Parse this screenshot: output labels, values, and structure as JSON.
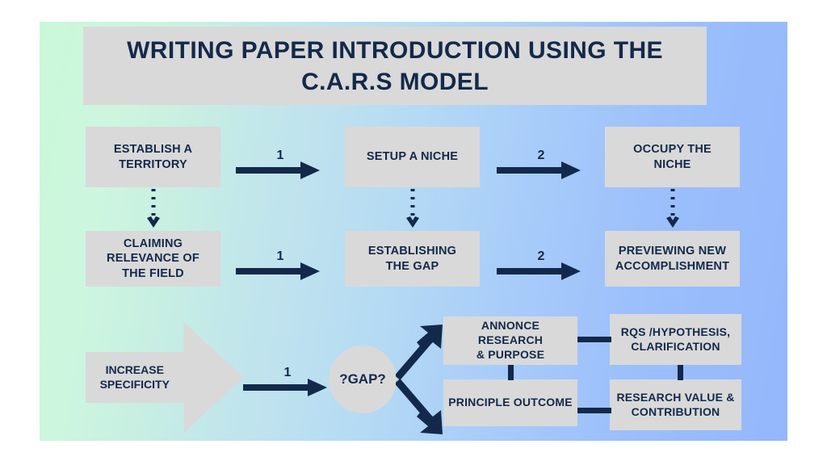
{
  "title": {
    "line1": "WRITING PAPER INTRODUCTION USING THE",
    "line2": "C.A.R.S MODEL"
  },
  "colors": {
    "node_fill": "#d9d9d9",
    "text_navy": "#13294b",
    "bg_left": "#c9f8d8",
    "bg_right": "#93b7fb",
    "page_bg": "#ffffff"
  },
  "row1": {
    "box1": "ESTABLISH A\nTERRITORY",
    "arrow1_label": "1",
    "box2": "SETUP A NICHE",
    "arrow2_label": "2",
    "box3": "OCCUPY THE\nNICHE"
  },
  "row2": {
    "box1": "CLAIMING\nRELEVANCE OF\nTHE  FIELD",
    "arrow1_label": "1",
    "box2": "ESTABLISHING\nTHE GAP",
    "arrow2_label": "2",
    "box3": "PREVIEWING NEW\nACCOMPLISHMENT"
  },
  "row3": {
    "increase": "INCREASE\nSPECIFICITY",
    "arrow1_label": "1",
    "gap": "?GAP?",
    "branch_top": "ANNONCE RESEARCH\n& PURPOSE",
    "branch_bottom": "PRINCIPLE OUTCOME",
    "result_top": "RQS /HYPOTHESIS,\nCLARIFICATION",
    "result_bottom": "RESEARCH VALUE &\nCONTRIBUTION"
  },
  "connectors": {
    "vertical_dotted_count": 3,
    "dotted_style": "dotted-down-arrow"
  },
  "chart_data": {
    "type": "diagram",
    "title": "WRITING PAPER INTRODUCTION USING THE C.A.R.S MODEL",
    "nodes": [
      {
        "id": "n1",
        "label": "ESTABLISH A TERRITORY",
        "row": 1,
        "col": 1
      },
      {
        "id": "n2",
        "label": "SETUP A NICHE",
        "row": 1,
        "col": 2
      },
      {
        "id": "n3",
        "label": "OCCUPY THE NICHE",
        "row": 1,
        "col": 3
      },
      {
        "id": "n4",
        "label": "CLAIMING RELEVANCE OF THE  FIELD",
        "row": 2,
        "col": 1
      },
      {
        "id": "n5",
        "label": "ESTABLISHING THE GAP",
        "row": 2,
        "col": 2
      },
      {
        "id": "n6",
        "label": "PREVIEWING NEW ACCOMPLISHMENT",
        "row": 2,
        "col": 3
      },
      {
        "id": "n7",
        "label": "INCREASE SPECIFICITY",
        "row": 3,
        "col": 1,
        "shape": "pentagon-arrow"
      },
      {
        "id": "n8",
        "label": "?GAP?",
        "row": 3,
        "col": 2,
        "shape": "circle"
      },
      {
        "id": "n9",
        "label": "ANNONCE RESEARCH & PURPOSE",
        "row": 3,
        "col": 3
      },
      {
        "id": "n10",
        "label": "PRINCIPLE OUTCOME",
        "row": 4,
        "col": 3
      },
      {
        "id": "n11",
        "label": "RQS /HYPOTHESIS, CLARIFICATION",
        "row": 3,
        "col": 4
      },
      {
        "id": "n12",
        "label": "RESEARCH VALUE & CONTRIBUTION",
        "row": 4,
        "col": 4
      }
    ],
    "edges": [
      {
        "from": "n1",
        "to": "n2",
        "label": "1",
        "style": "solid-arrow"
      },
      {
        "from": "n2",
        "to": "n3",
        "label": "2",
        "style": "solid-arrow"
      },
      {
        "from": "n4",
        "to": "n5",
        "label": "1",
        "style": "solid-arrow"
      },
      {
        "from": "n5",
        "to": "n6",
        "label": "2",
        "style": "solid-arrow"
      },
      {
        "from": "n1",
        "to": "n4",
        "label": "",
        "style": "dotted-arrow"
      },
      {
        "from": "n2",
        "to": "n5",
        "label": "",
        "style": "dotted-arrow"
      },
      {
        "from": "n3",
        "to": "n6",
        "label": "",
        "style": "dotted-arrow"
      },
      {
        "from": "n7",
        "to": "n8",
        "label": "1",
        "style": "solid-arrow"
      },
      {
        "from": "n8",
        "to": "n9",
        "label": "",
        "style": "solid-arrow"
      },
      {
        "from": "n8",
        "to": "n10",
        "label": "",
        "style": "solid-arrow"
      },
      {
        "from": "n9",
        "to": "n11",
        "label": "",
        "style": "bar"
      },
      {
        "from": "n9",
        "to": "n10",
        "label": "",
        "style": "bar"
      },
      {
        "from": "n11",
        "to": "n12",
        "label": "",
        "style": "bar"
      },
      {
        "from": "n10",
        "to": "n12",
        "label": "",
        "style": "bar"
      }
    ]
  }
}
